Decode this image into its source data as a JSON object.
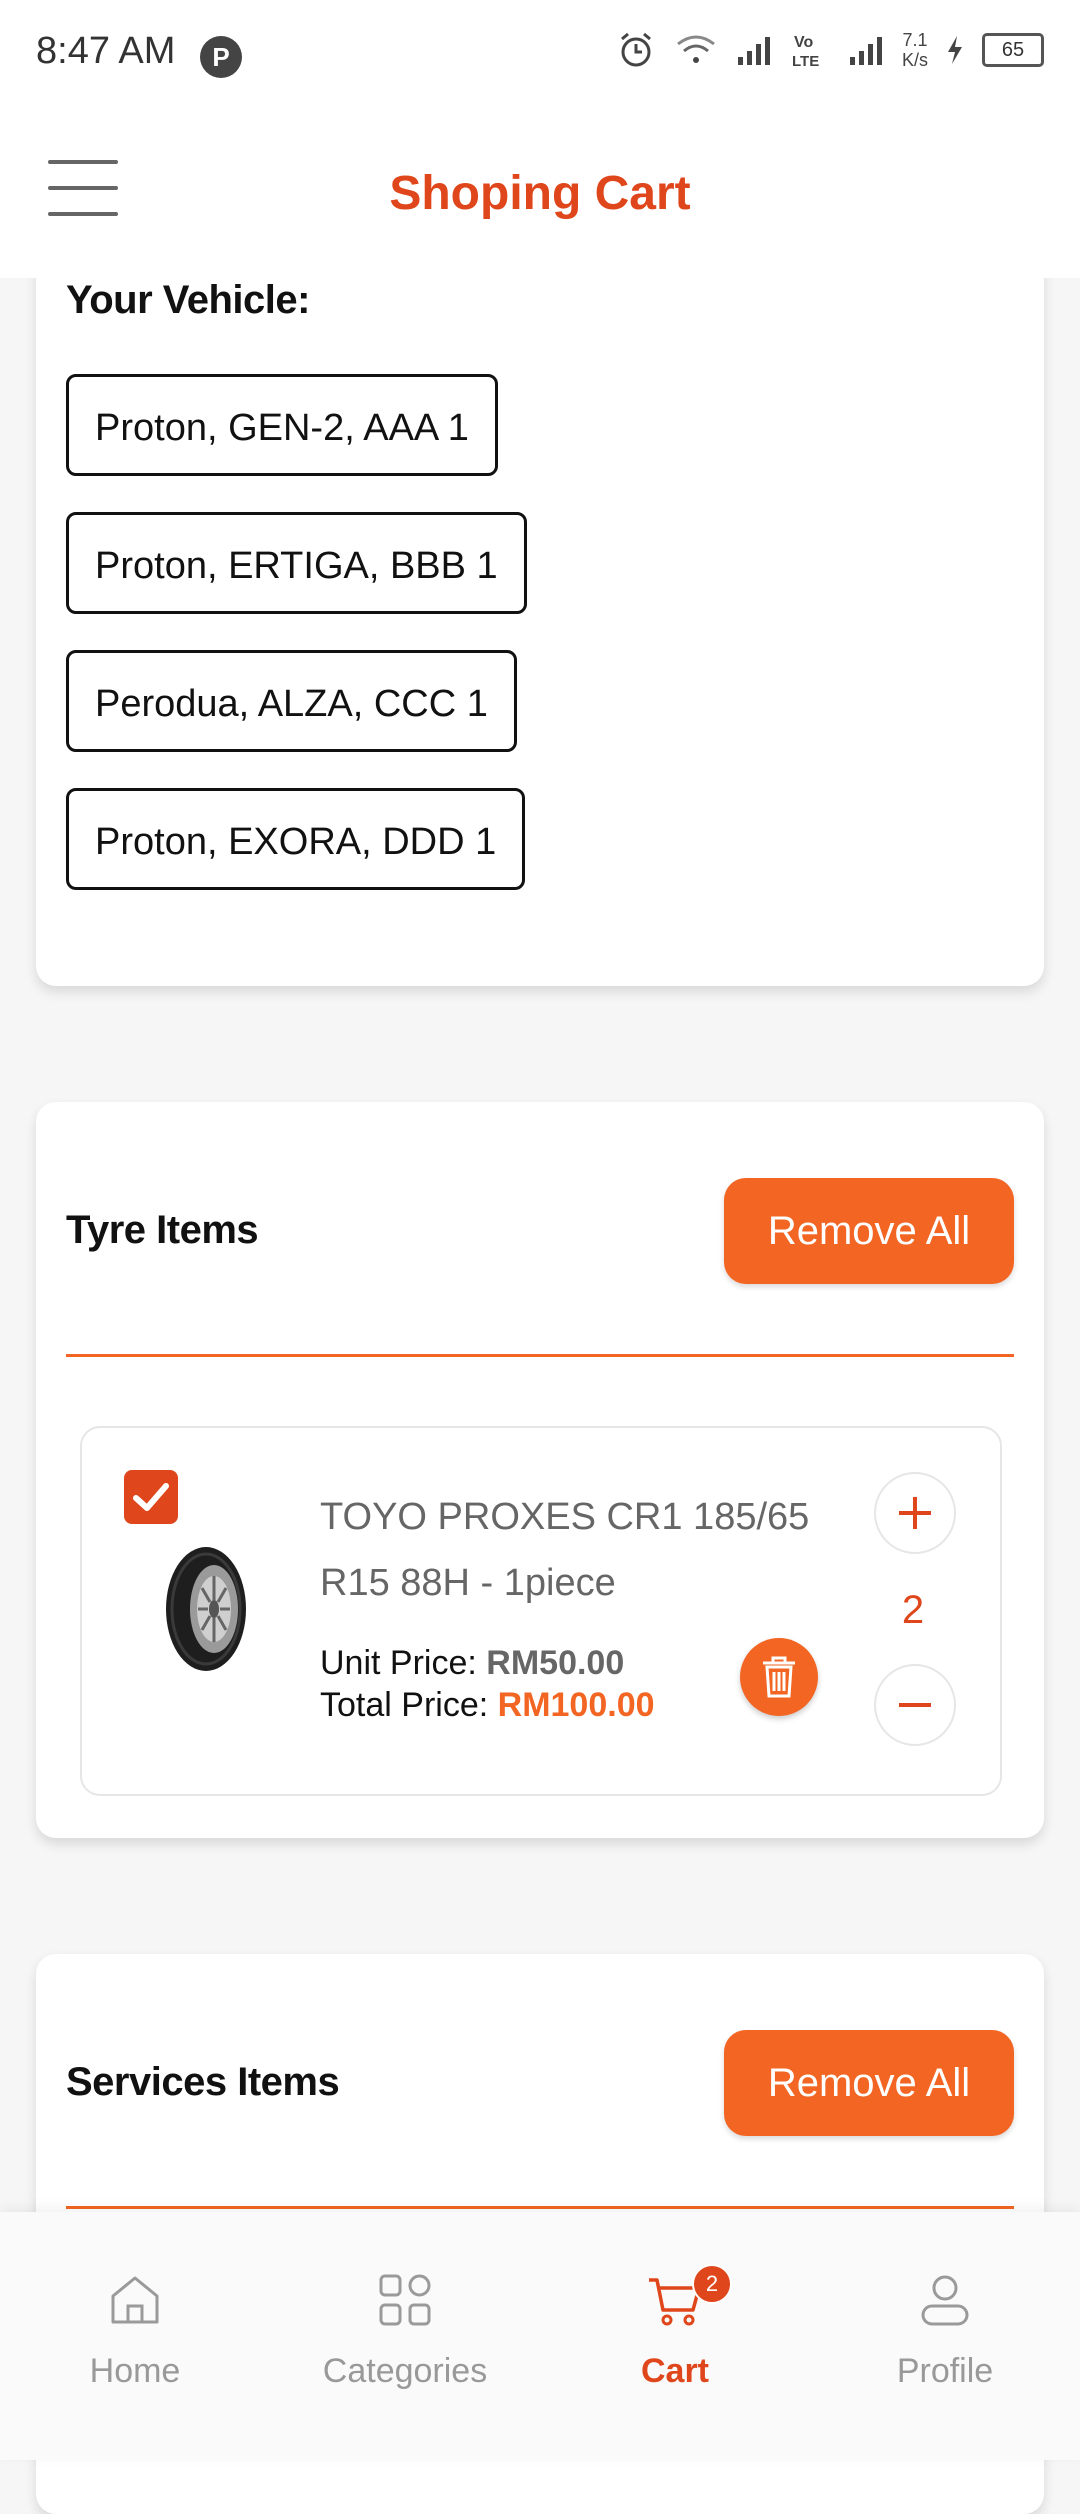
{
  "status_bar": {
    "time": "8:47 AM",
    "p_icon": "P",
    "net_speed_value": "7.1",
    "net_speed_unit": "K/s",
    "battery": "65",
    "icons": [
      "alarm-icon",
      "wifi-icon",
      "signal-icon",
      "volte-icon",
      "signal-icon",
      "charging-icon"
    ]
  },
  "header": {
    "title": "Shoping Cart",
    "menu_icon": "hamburger-menu-icon"
  },
  "vehicles": {
    "label": "Your Vehicle:",
    "items": [
      "Proton, GEN-2, AAA 1",
      "Proton, ERTIGA, BBB 1",
      "Perodua, ALZA, CCC 1",
      "Proton, EXORA, DDD 1"
    ]
  },
  "tyre_section": {
    "title": "Tyre Items",
    "remove_all_label": "Remove All",
    "items": [
      {
        "checked": true,
        "name": "TOYO PROXES CR1 185/65 R15 88H - 1piece",
        "unit_price_label": "Unit Price:",
        "unit_price": "RM50.00",
        "total_price_label": "Total Price:",
        "total_price": "RM100.00",
        "quantity": "2"
      }
    ]
  },
  "services_section": {
    "title": "Services Items",
    "remove_all_label": "Remove All"
  },
  "bottom_nav": {
    "items": [
      {
        "label": "Home",
        "icon": "home-icon",
        "active": false
      },
      {
        "label": "Categories",
        "icon": "categories-icon",
        "active": false
      },
      {
        "label": "Cart",
        "icon": "cart-icon",
        "active": true,
        "badge": "2"
      },
      {
        "label": "Profile",
        "icon": "profile-icon",
        "active": false
      }
    ]
  },
  "colors": {
    "accent": "#f26522",
    "title_red": "#e0461b",
    "muted": "#999999"
  }
}
